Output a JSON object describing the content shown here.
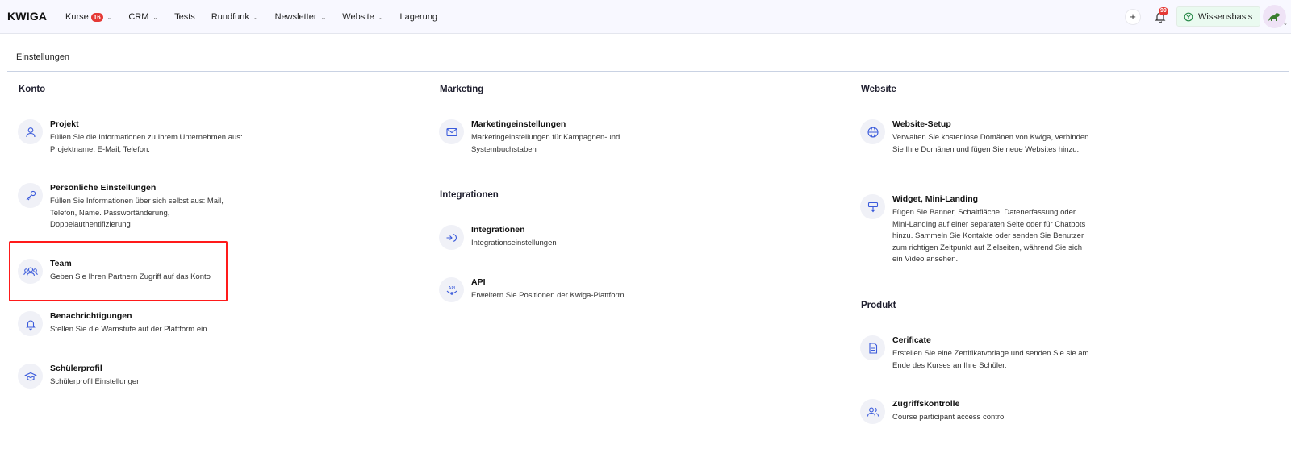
{
  "app": {
    "logo": "KWIGA"
  },
  "nav": [
    {
      "label": "Kurse",
      "badge": "16",
      "dropdown": true
    },
    {
      "label": "CRM",
      "badge": "",
      "dropdown": true
    },
    {
      "label": "Tests",
      "badge": "",
      "dropdown": false
    },
    {
      "label": "Rundfunk",
      "badge": "",
      "dropdown": true
    },
    {
      "label": "Newsletter",
      "badge": "",
      "dropdown": true
    },
    {
      "label": "Website",
      "badge": "",
      "dropdown": true
    },
    {
      "label": "Lagerung",
      "badge": "",
      "dropdown": false
    }
  ],
  "header": {
    "plus": "+",
    "bell_badge": "99",
    "knowledge_base": "Wissensbasis"
  },
  "page": {
    "title": "Einstellungen"
  },
  "sections": {
    "konto": {
      "title": "Konto",
      "items": [
        {
          "title": "Projekt",
          "desc": "Füllen Sie die Informationen zu Ihrem Unternehmen aus: Projektname, E-Mail, Telefon.",
          "icon": "user-icon"
        },
        {
          "title": "Persönliche Einstellungen",
          "desc": "Füllen Sie Informationen über sich selbst aus: Mail, Telefon, Name. Passwortänderung, Doppelauthentifizierung",
          "icon": "key-icon"
        },
        {
          "title": "Team",
          "desc": "Geben Sie Ihren Partnern Zugriff auf das Konto",
          "icon": "team-icon"
        },
        {
          "title": "Benachrichtigungen",
          "desc": "Stellen Sie die Warnstufe auf der Plattform ein",
          "icon": "bell-icon"
        },
        {
          "title": "Schülerprofil",
          "desc": "Schülerprofil Einstellungen",
          "icon": "graduation-cap-icon"
        }
      ]
    },
    "marketing": {
      "title": "Marketing",
      "items": [
        {
          "title": "Marketingeinstellungen",
          "desc": "Marketingeinstellungen für Kampagnen-und Systembuchstaben",
          "icon": "mail-icon"
        }
      ]
    },
    "integrationen": {
      "title": "Integrationen",
      "items": [
        {
          "title": "Integrationen",
          "desc": "Integrationseinstellungen",
          "icon": "plug-in-icon"
        },
        {
          "title": "API",
          "desc": "Erweitern Sie Positionen der Kwiga-Plattform",
          "icon": "api-icon",
          "icon_text": "API"
        }
      ]
    },
    "website": {
      "title": "Website",
      "items": [
        {
          "title": "Website-Setup",
          "desc": "Verwalten Sie kostenlose Domänen von Kwiga, verbinden Sie Ihre Domänen und fügen Sie neue Websites hinzu.",
          "icon": "globe-icon"
        },
        {
          "title": "Widget, Mini-Landing",
          "desc": "Fügen Sie Banner, Schaltfläche, Datenerfassung oder Mini-Landing auf einer separaten Seite oder für Chatbots hinzu. Sammeln Sie Kontakte oder senden Sie Benutzer zum richtigen Zeitpunkt auf Zielseiten, während Sie sich ein Video ansehen.",
          "icon": "widget-icon"
        }
      ]
    },
    "produkt": {
      "title": "Produkt",
      "items": [
        {
          "title": "Cerificate",
          "desc": "Erstellen Sie eine Zertifikatvorlage und senden Sie sie am Ende des Kurses an Ihre Schüler.",
          "icon": "certificate-icon"
        },
        {
          "title": "Zugriffskontrolle",
          "desc": "Course participant access control",
          "icon": "access-control-icon"
        }
      ]
    }
  },
  "colors": {
    "accent": "#3b5bdb",
    "highlight": "#ff1a1a",
    "nav_badge": "#e53935"
  }
}
